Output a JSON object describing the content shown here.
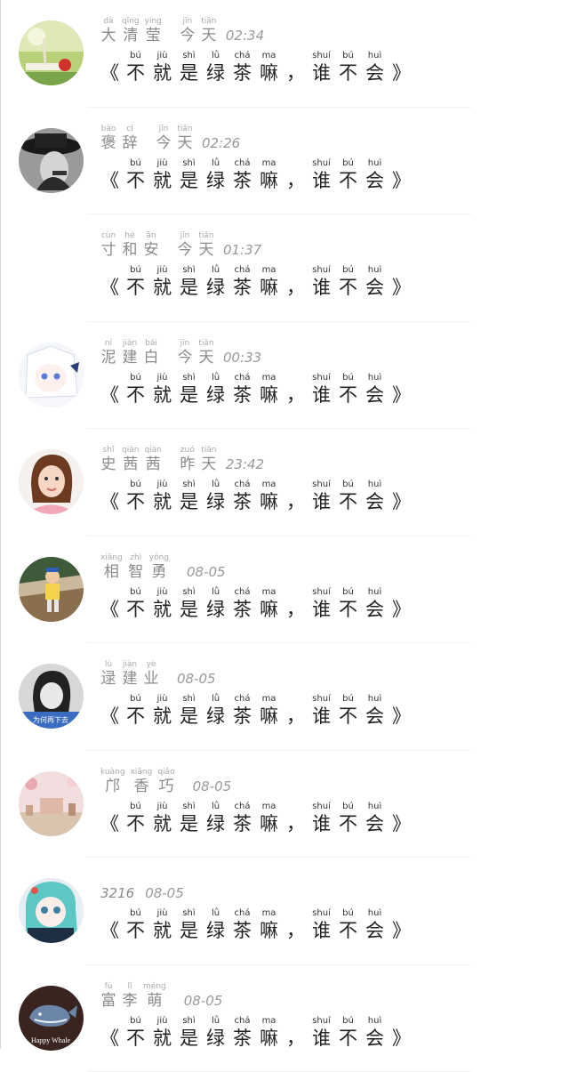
{
  "message": {
    "open_quote": "《",
    "close_quote": "》",
    "comma": "，",
    "chars": [
      {
        "py": "bú",
        "hz": "不"
      },
      {
        "py": "jiù",
        "hz": "就"
      },
      {
        "py": "shì",
        "hz": "是"
      },
      {
        "py": "lǜ",
        "hz": "绿"
      },
      {
        "py": "chá",
        "hz": "茶"
      },
      {
        "py": "ma",
        "hz": "嘛"
      }
    ],
    "chars2": [
      {
        "py": "shuí",
        "hz": "谁"
      },
      {
        "py": "bú",
        "hz": "不"
      },
      {
        "py": "huì",
        "hz": "会"
      }
    ]
  },
  "comments": [
    {
      "name": [
        {
          "py": "dà",
          "hz": "大"
        },
        {
          "py": "qīng",
          "hz": "清"
        },
        {
          "py": "yíng",
          "hz": "莹"
        }
      ],
      "day": [
        {
          "py": "jīn",
          "hz": "今"
        },
        {
          "py": "tiān",
          "hz": "天"
        }
      ],
      "time": "02:34",
      "avatar": "avatar-book-flower"
    },
    {
      "name": [
        {
          "py": "bāo",
          "hz": "褒"
        },
        {
          "py": "cí",
          "hz": "辞"
        }
      ],
      "day": [
        {
          "py": "jīn",
          "hz": "今"
        },
        {
          "py": "tiān",
          "hz": "天"
        }
      ],
      "time": "02:26",
      "avatar": "avatar-hat-person"
    },
    {
      "name": [
        {
          "py": "cùn",
          "hz": "寸"
        },
        {
          "py": "hé",
          "hz": "和"
        },
        {
          "py": "ān",
          "hz": "安"
        }
      ],
      "day": [
        {
          "py": "jīn",
          "hz": "今"
        },
        {
          "py": "tiān",
          "hz": "天"
        }
      ],
      "time": "01:37",
      "avatar": ""
    },
    {
      "name": [
        {
          "py": "ní",
          "hz": "泥"
        },
        {
          "py": "jiàn",
          "hz": "建"
        },
        {
          "py": "bái",
          "hz": "白"
        }
      ],
      "day": [
        {
          "py": "jīn",
          "hz": "今"
        },
        {
          "py": "tiān",
          "hz": "天"
        }
      ],
      "time": "00:33",
      "avatar": "avatar-anime-white"
    },
    {
      "name": [
        {
          "py": "shǐ",
          "hz": "史"
        },
        {
          "py": "qiàn",
          "hz": "茜"
        },
        {
          "py": "qiàn",
          "hz": "茜"
        }
      ],
      "day": [
        {
          "py": "zuó",
          "hz": "昨"
        },
        {
          "py": "tiān",
          "hz": "天"
        }
      ],
      "time": "23:42",
      "avatar": "avatar-girl-pink"
    },
    {
      "name": [
        {
          "py": "xiāng",
          "hz": "相"
        },
        {
          "py": "zhì",
          "hz": "智"
        },
        {
          "py": "yǒng",
          "hz": "勇"
        }
      ],
      "day": [],
      "time": "08-05",
      "avatar": "avatar-kid-street"
    },
    {
      "name": [
        {
          "py": "lù",
          "hz": "逯"
        },
        {
          "py": "jiàn",
          "hz": "建"
        },
        {
          "py": "yè",
          "hz": "业"
        }
      ],
      "day": [],
      "time": "08-05",
      "avatar": "avatar-bw-girl"
    },
    {
      "name": [
        {
          "py": "kuàng",
          "hz": "邝"
        },
        {
          "py": "xiāng",
          "hz": "香"
        },
        {
          "py": "qiǎo",
          "hz": "巧"
        }
      ],
      "day": [],
      "time": "08-05",
      "avatar": "avatar-pink-room"
    },
    {
      "plain_name": "3216",
      "name": [],
      "day": [],
      "time": "08-05",
      "avatar": "avatar-anime-teal"
    },
    {
      "name": [
        {
          "py": "fù",
          "hz": "富"
        },
        {
          "py": "lǐ",
          "hz": "李"
        },
        {
          "py": "méng",
          "hz": "萌"
        }
      ],
      "day": [],
      "time": "08-05",
      "avatar": "avatar-happy-whale",
      "avatar_text": "Happy Whale"
    }
  ]
}
